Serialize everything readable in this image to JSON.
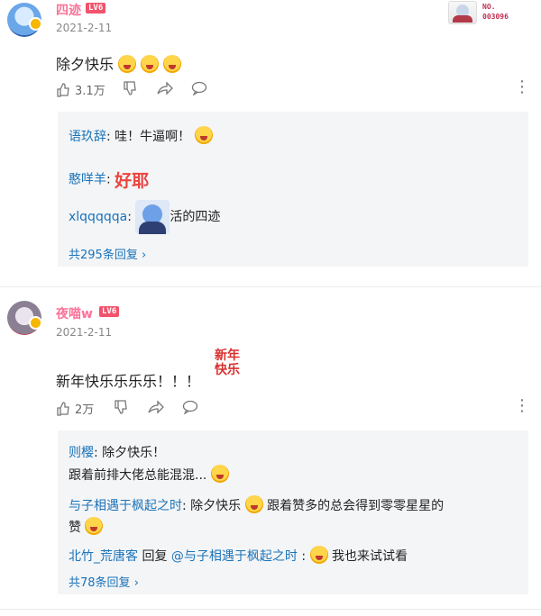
{
  "comments": [
    {
      "username": "四迹",
      "level": "LV6",
      "date": "2021-2-11",
      "text": "除夕快乐",
      "likes": "3.1万",
      "fan_badge": {
        "no_label": "NO.",
        "number": "003096"
      },
      "replies": [
        {
          "name": "语玖辞",
          "text": "哇！牛逼啊！"
        },
        {
          "name": "憨咩羊",
          "sticker_text": "好耶"
        },
        {
          "name": "xlqqqqqa",
          "text": "活的四迹"
        }
      ],
      "more_replies": "共295条回复"
    },
    {
      "username": "夜喵w",
      "level": "LV6",
      "date": "2021-2-11",
      "text": "新年快乐乐乐乐！！！",
      "sticker_text": "新年快乐",
      "likes": "2万",
      "replies": [
        {
          "name": "则樱",
          "text1": "除夕快乐！",
          "text2": "跟着前排大佬总能混混..."
        },
        {
          "name": "与子相遇于枫起之时",
          "text1": "除夕快乐",
          "text2": "跟着赞多的总会得到零零星星的",
          "text3": "赞"
        },
        {
          "name": "北竹_荒唐客",
          "reply_word": "回复",
          "mention": "@与子相遇于枫起之时",
          "text": "我也来试试看"
        }
      ],
      "more_replies": "共78条回复"
    }
  ],
  "colors": {
    "username": "#fb7299",
    "link": "#1a73b8",
    "level_badge": "#f2526b"
  }
}
